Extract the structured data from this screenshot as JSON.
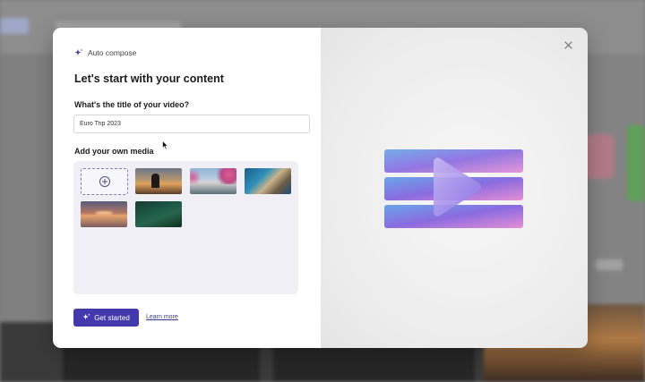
{
  "dialog": {
    "app_name": "Auto compose",
    "heading": "Let's start with your content",
    "title_field": {
      "label": "What's the title of your video?",
      "value": "Euro Trip 2023"
    },
    "media_section": {
      "label": "Add your own media",
      "thumbnails": [
        "sunset-person",
        "coast-flowers",
        "beach-cliffs",
        "sea-sunset",
        "forest-aerial"
      ]
    },
    "get_started_label": "Get started",
    "learn_more_label": "Learn more"
  },
  "icons": {
    "header": "sparkle-icon",
    "close": "close-icon",
    "add_media": "plus-circle-icon",
    "button": "sparkle-icon",
    "hero": "video-play-icon"
  },
  "colors": {
    "accent": "#4338ac",
    "link": "#3b3a8f",
    "hero_gradient": [
      "#6aa5e8",
      "#8a6be0",
      "#e48fd6"
    ]
  }
}
